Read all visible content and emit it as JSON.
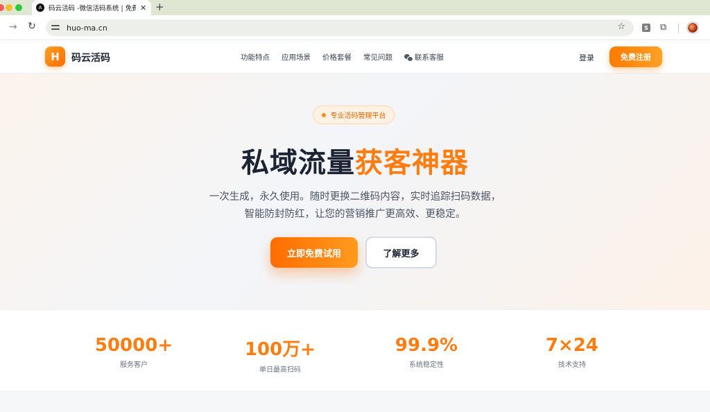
{
  "browser": {
    "tab_title": "码云活码 -微信活码系统 | 免费",
    "tab_favicon": "A",
    "url": "huo-ma.cn",
    "ext_badge": "S",
    "icons": [
      "forward-arrow-icon",
      "reload-icon",
      "site-info-icon",
      "star-icon",
      "extension-s-icon",
      "puzzle-icon",
      "profile-avatar"
    ]
  },
  "header": {
    "logo_mark": "H",
    "logo_text": "码云活码",
    "nav": [
      "功能特点",
      "应用场景",
      "价格套餐",
      "常见问题",
      "联系客服"
    ],
    "login": "登录",
    "register": "免费注册"
  },
  "hero": {
    "badge": "专业活码管理平台",
    "title_main": "私域流量",
    "title_accent": "获客神器",
    "desc_line1": "一次生成，永久使用。随时更换二维码内容，实时追踪扫码数据，",
    "desc_line2": "智能防封防红，让您的营销推广更高效、更稳定。",
    "primary_cta": "立即免费试用",
    "secondary_cta": "了解更多"
  },
  "stats": [
    {
      "value": "50000+",
      "label": "服务客户"
    },
    {
      "value": "100万+",
      "label": "单日最高扫码"
    },
    {
      "value": "99.9%",
      "label": "系统稳定性"
    },
    {
      "value": "7×24",
      "label": "技术支持"
    }
  ],
  "colors": {
    "accent": "#ff7d10",
    "dark_text": "#1c2433",
    "tabbar": "#dfe7d3"
  }
}
